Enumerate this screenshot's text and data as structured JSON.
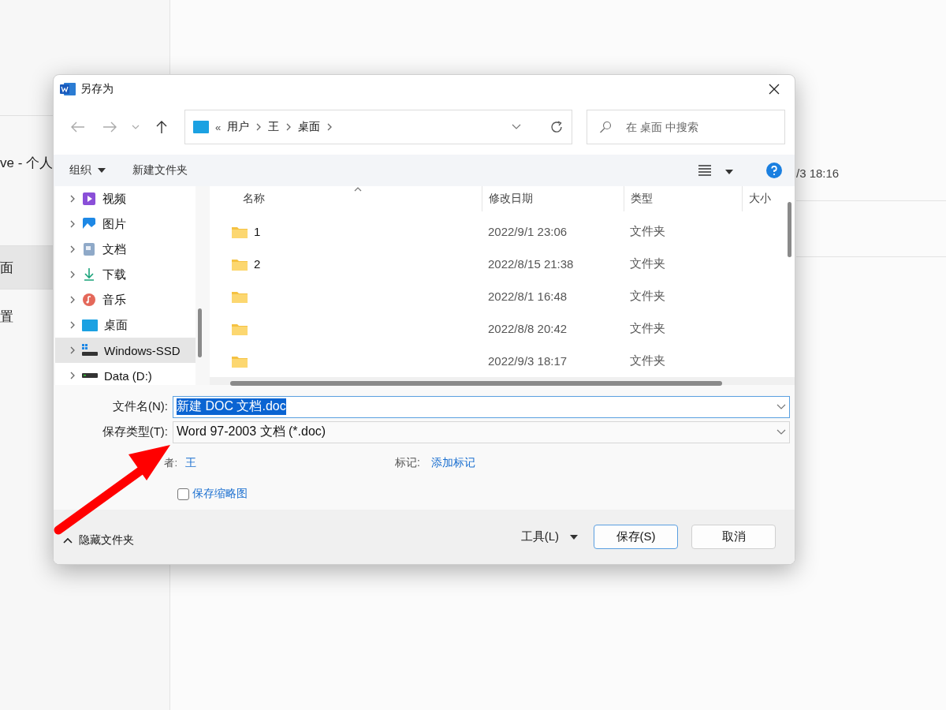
{
  "background_app": {
    "sidebar_items": [
      {
        "label": "ve - 个人",
        "selected": false
      },
      {
        "label": "面",
        "selected": true
      },
      {
        "label": "置",
        "selected": false
      }
    ],
    "list_time": "/3 18:16"
  },
  "window": {
    "title": "另存为"
  },
  "breadcrumb": {
    "prefix": "«",
    "parts": [
      "用户",
      "王",
      "桌面"
    ]
  },
  "search": {
    "placeholder": "在 桌面 中搜索"
  },
  "toolbar": {
    "organize": "组织",
    "new_folder": "新建文件夹"
  },
  "nav_pane": {
    "items": [
      {
        "label": "视频",
        "kind": "video",
        "expanded": false,
        "selected": false
      },
      {
        "label": "图片",
        "kind": "pictures",
        "expanded": false,
        "selected": false
      },
      {
        "label": "文档",
        "kind": "documents",
        "expanded": false,
        "selected": false
      },
      {
        "label": "下载",
        "kind": "downloads",
        "expanded": false,
        "selected": false
      },
      {
        "label": "音乐",
        "kind": "music",
        "expanded": false,
        "selected": false
      },
      {
        "label": "桌面",
        "kind": "desktop",
        "expanded": false,
        "selected": false
      },
      {
        "label": "Windows-SSD",
        "kind": "drive_system",
        "expanded": false,
        "selected": true
      },
      {
        "label": "Data (D:)",
        "kind": "drive",
        "expanded": false,
        "selected": false
      }
    ]
  },
  "table": {
    "columns": [
      "名称",
      "修改日期",
      "类型",
      "大小"
    ],
    "rows": [
      {
        "name": "1",
        "date": "2022/9/1 23:06",
        "type": "文件夹"
      },
      {
        "name": "2",
        "date": "2022/8/15 21:38",
        "type": "文件夹"
      },
      {
        "date": "2022/8/1 16:48",
        "type": "文件夹"
      },
      {
        "date": "2022/8/8 20:42",
        "type": "文件夹"
      },
      {
        "date": "2022/9/3 18:17",
        "type": "文件夹"
      }
    ]
  },
  "form": {
    "filename_label": "文件名(N):",
    "filename": {
      "value": "新建 DOC 文档.doc",
      "selected": true
    },
    "type_label": "保存类型(T):",
    "type_value": "Word 97-2003 文档 (*.doc)",
    "author_label": "者:",
    "author": "王",
    "tags_label": "标记:",
    "tags": "添加标记",
    "thumbnail": {
      "label": "保存缩略图",
      "checked": false
    }
  },
  "footer": {
    "hide_folders": "隐藏文件夹",
    "tools": "工具(L)",
    "save": "保存(S)",
    "cancel": "取消"
  }
}
